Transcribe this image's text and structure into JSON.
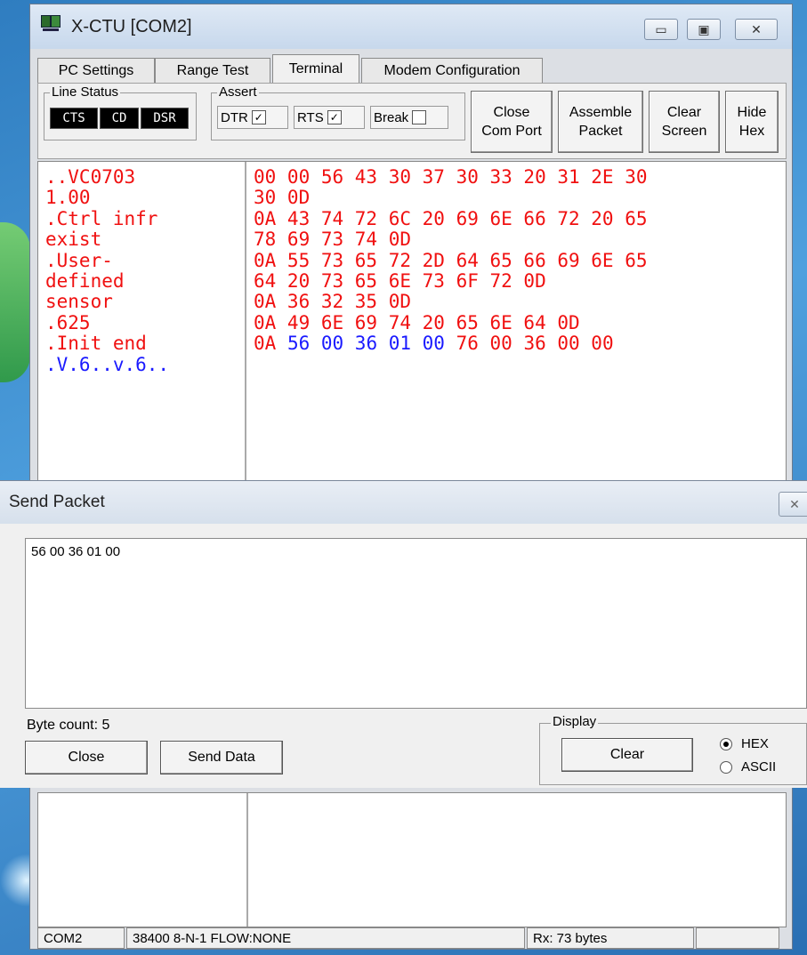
{
  "window": {
    "title": "X-CTU  [COM2]",
    "min": "▭",
    "max": "▣",
    "close": "✕"
  },
  "tabs": [
    "PC Settings",
    "Range Test",
    "Terminal",
    "Modem Configuration"
  ],
  "line_status": {
    "label": "Line Status",
    "leds": [
      "CTS",
      "CD",
      "DSR"
    ]
  },
  "assert": {
    "label": "Assert",
    "dtr": "DTR",
    "dtr_checked": "✓",
    "rts": "RTS",
    "rts_checked": "✓",
    "brk": "Break",
    "brk_checked": ""
  },
  "buttons": {
    "close_port_1": "Close",
    "close_port_2": "Com Port",
    "assemble_1": "Assemble",
    "assemble_2": "Packet",
    "clear_1": "Clear",
    "clear_2": "Screen",
    "hide_1": "Hide",
    "hide_2": "Hex"
  },
  "terminal": {
    "ascii_lines": [
      {
        "text": "..VC0703",
        "color": "red"
      },
      {
        "text": "1.00",
        "color": "red"
      },
      {
        "text": ".Ctrl infr",
        "color": "red"
      },
      {
        "text": "exist",
        "color": "red"
      },
      {
        "text": ".User-",
        "color": "red"
      },
      {
        "text": "defined",
        "color": "red"
      },
      {
        "text": "sensor",
        "color": "red"
      },
      {
        "text": ".625",
        "color": "red"
      },
      {
        "text": ".Init end",
        "color": "red"
      },
      {
        "text": ".V.6..v.6..",
        "color": "blue"
      }
    ],
    "hex_lines": [
      [
        [
          "00 00 56 43 30 37 30 33 20 31 2E 30",
          "red"
        ]
      ],
      [
        [
          "30 0D",
          "red"
        ]
      ],
      [
        [
          "0A 43 74 72 6C 20 69 6E 66 72 20 65",
          "red"
        ]
      ],
      [
        [
          "78 69 73 74 0D",
          "red"
        ]
      ],
      [
        [
          "0A 55 73 65 72 2D 64 65 66 69 6E 65",
          "red"
        ]
      ],
      [
        [
          "64 20 73 65 6E 73 6F 72 0D",
          "red"
        ]
      ],
      [
        [
          "0A 36 32 35 0D",
          "red"
        ]
      ],
      [
        [
          "0A 49 6E 69 74 20 65 6E 64 0D",
          "red"
        ]
      ],
      [
        [
          "0A ",
          "red"
        ],
        [
          "56 00 36 01 00 ",
          "blue"
        ],
        [
          "76 00 36 00 00",
          "red"
        ]
      ]
    ]
  },
  "send_packet": {
    "title": "Send Packet",
    "close_x": "✕",
    "content": "56 00 36 01 00",
    "byte_count": "Byte count: 5",
    "close_btn": "Close",
    "send_btn": "Send Data",
    "display_label": "Display",
    "clear_btn": "Clear",
    "hex_option": "HEX",
    "ascii_option": "ASCII",
    "selected": "HEX"
  },
  "status_bar": {
    "port": "COM2",
    "settings": "38400 8-N-1  FLOW:NONE",
    "rx": "Rx: 73 bytes",
    "extra": ""
  },
  "colors": {
    "red": "#f01010",
    "blue": "#1a1aff"
  }
}
